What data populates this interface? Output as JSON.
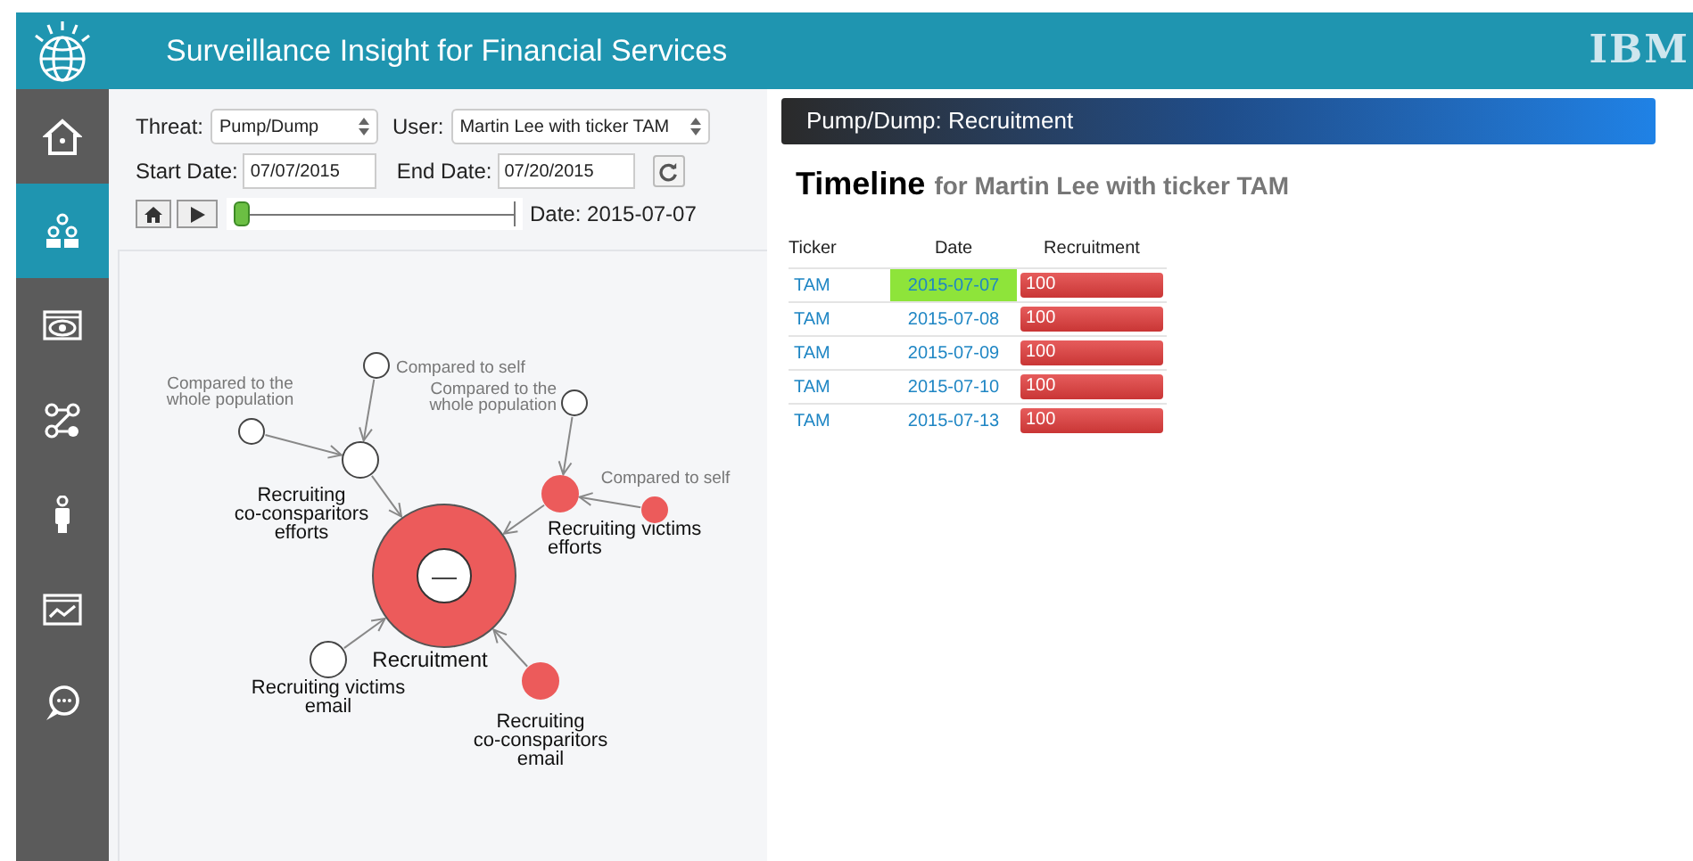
{
  "header": {
    "title": "Surveillance Insight for Financial Services",
    "brand": "IBM"
  },
  "sidebar": {
    "items": [
      {
        "kind": "home",
        "selected": false
      },
      {
        "kind": "group",
        "selected": true
      },
      {
        "kind": "eye",
        "selected": false
      },
      {
        "kind": "network",
        "selected": false
      },
      {
        "kind": "person",
        "selected": false
      },
      {
        "kind": "chart",
        "selected": false
      },
      {
        "kind": "chat",
        "selected": false
      }
    ]
  },
  "filters": {
    "threat": {
      "label": "Threat:",
      "value": "Pump/Dump"
    },
    "user": {
      "label": "User:",
      "value": "Martin Lee with ticker TAM"
    },
    "start_date": {
      "label": "Start Date:",
      "value": "07/07/2015"
    },
    "end_date": {
      "label": "End Date:",
      "value": "07/20/2015"
    },
    "timeline_slider": {
      "level": 0,
      "reading": "Date: 2015-07-07"
    }
  },
  "graph": {
    "root": {
      "label": "Recruitment",
      "flagged": true,
      "collapse_symbol": "—",
      "children": [
        {
          "label": "Recruiting co-consparitors efforts",
          "flagged": false,
          "children": [
            {
              "label": "Compared to self",
              "flagged": false
            },
            {
              "label": "Compared to the whole population",
              "flagged": false
            }
          ]
        },
        {
          "label": "Recruiting victims efforts",
          "flagged": true,
          "children": [
            {
              "label": "Compared to the whole population",
              "flagged": false
            },
            {
              "label": "Compared to self",
              "flagged": true
            }
          ]
        },
        {
          "label": "Recruiting victims email",
          "flagged": false
        },
        {
          "label": "Recruiting co-consparitors email",
          "flagged": true
        }
      ]
    }
  },
  "detail": {
    "title": "Pump/Dump: Recruitment",
    "heading": "Timeline",
    "subheading": "for Martin Lee with ticker TAM",
    "table": {
      "columns": [
        "Ticker",
        "Date",
        "Recruitment"
      ],
      "rows": [
        {
          "ticker": "TAM",
          "date": "2015-07-07",
          "selected": true,
          "recruitment": "100"
        },
        {
          "ticker": "TAM",
          "date": "2015-07-08",
          "selected": false,
          "recruitment": "100"
        },
        {
          "ticker": "TAM",
          "date": "2015-07-09",
          "selected": false,
          "recruitment": "100"
        },
        {
          "ticker": "TAM",
          "date": "2015-07-10",
          "selected": false,
          "recruitment": "100"
        },
        {
          "ticker": "TAM",
          "date": "2015-07-13",
          "selected": false,
          "recruitment": "100"
        }
      ]
    }
  }
}
